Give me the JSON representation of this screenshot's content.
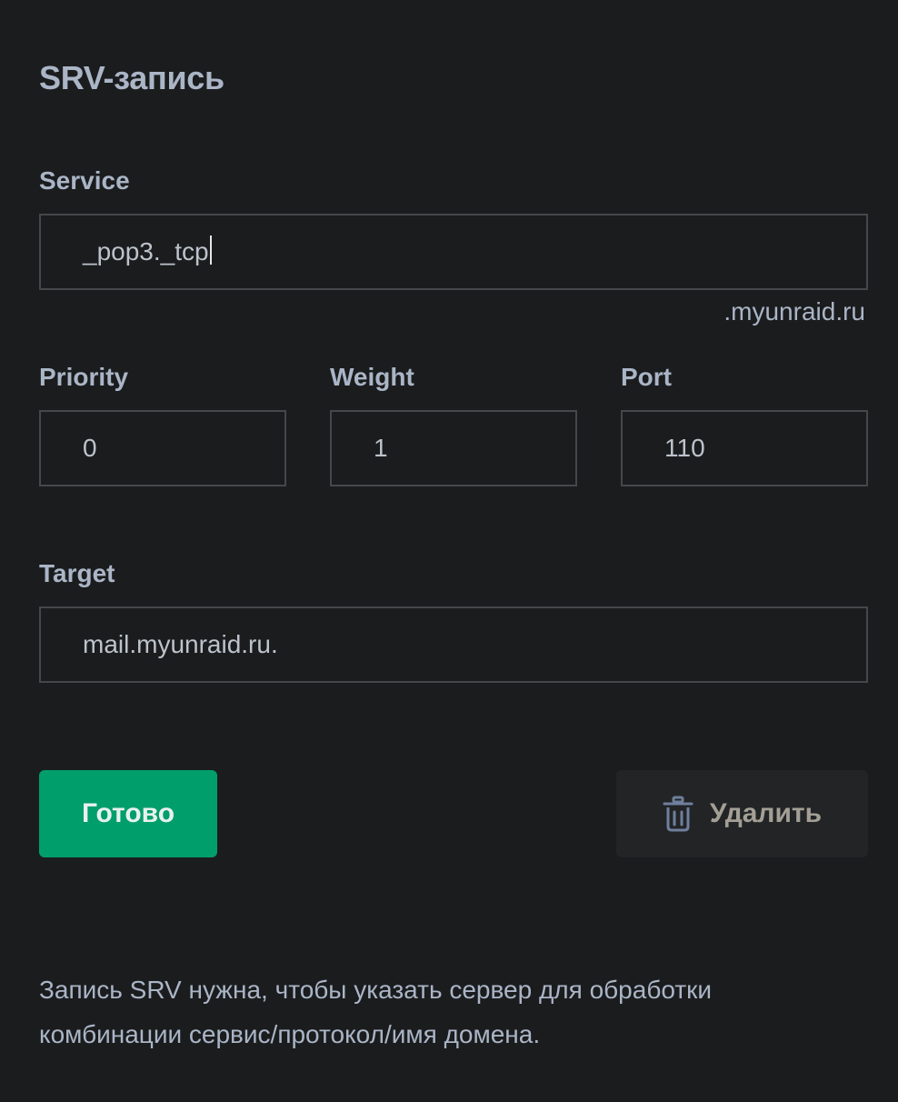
{
  "title": "SRV-запись",
  "service": {
    "label": "Service",
    "value": "_pop3._tcp",
    "suffix": ".myunraid.ru"
  },
  "priority": {
    "label": "Priority",
    "value": "0"
  },
  "weight": {
    "label": "Weight",
    "value": "1"
  },
  "port": {
    "label": "Port",
    "value": "110"
  },
  "target": {
    "label": "Target",
    "value": "mail.myunraid.ru."
  },
  "actions": {
    "done_label": "Готово",
    "delete_label": "Удалить",
    "delete_icon": "trash-icon"
  },
  "description": "Запись SRV нужна, чтобы указать сервер для обработки комбинации сервис/протокол/имя домена.",
  "colors": {
    "background": "#1b1c1e",
    "accent_green": "#009e6b",
    "label_text": "#aab5c6",
    "field_border": "#45474a"
  }
}
